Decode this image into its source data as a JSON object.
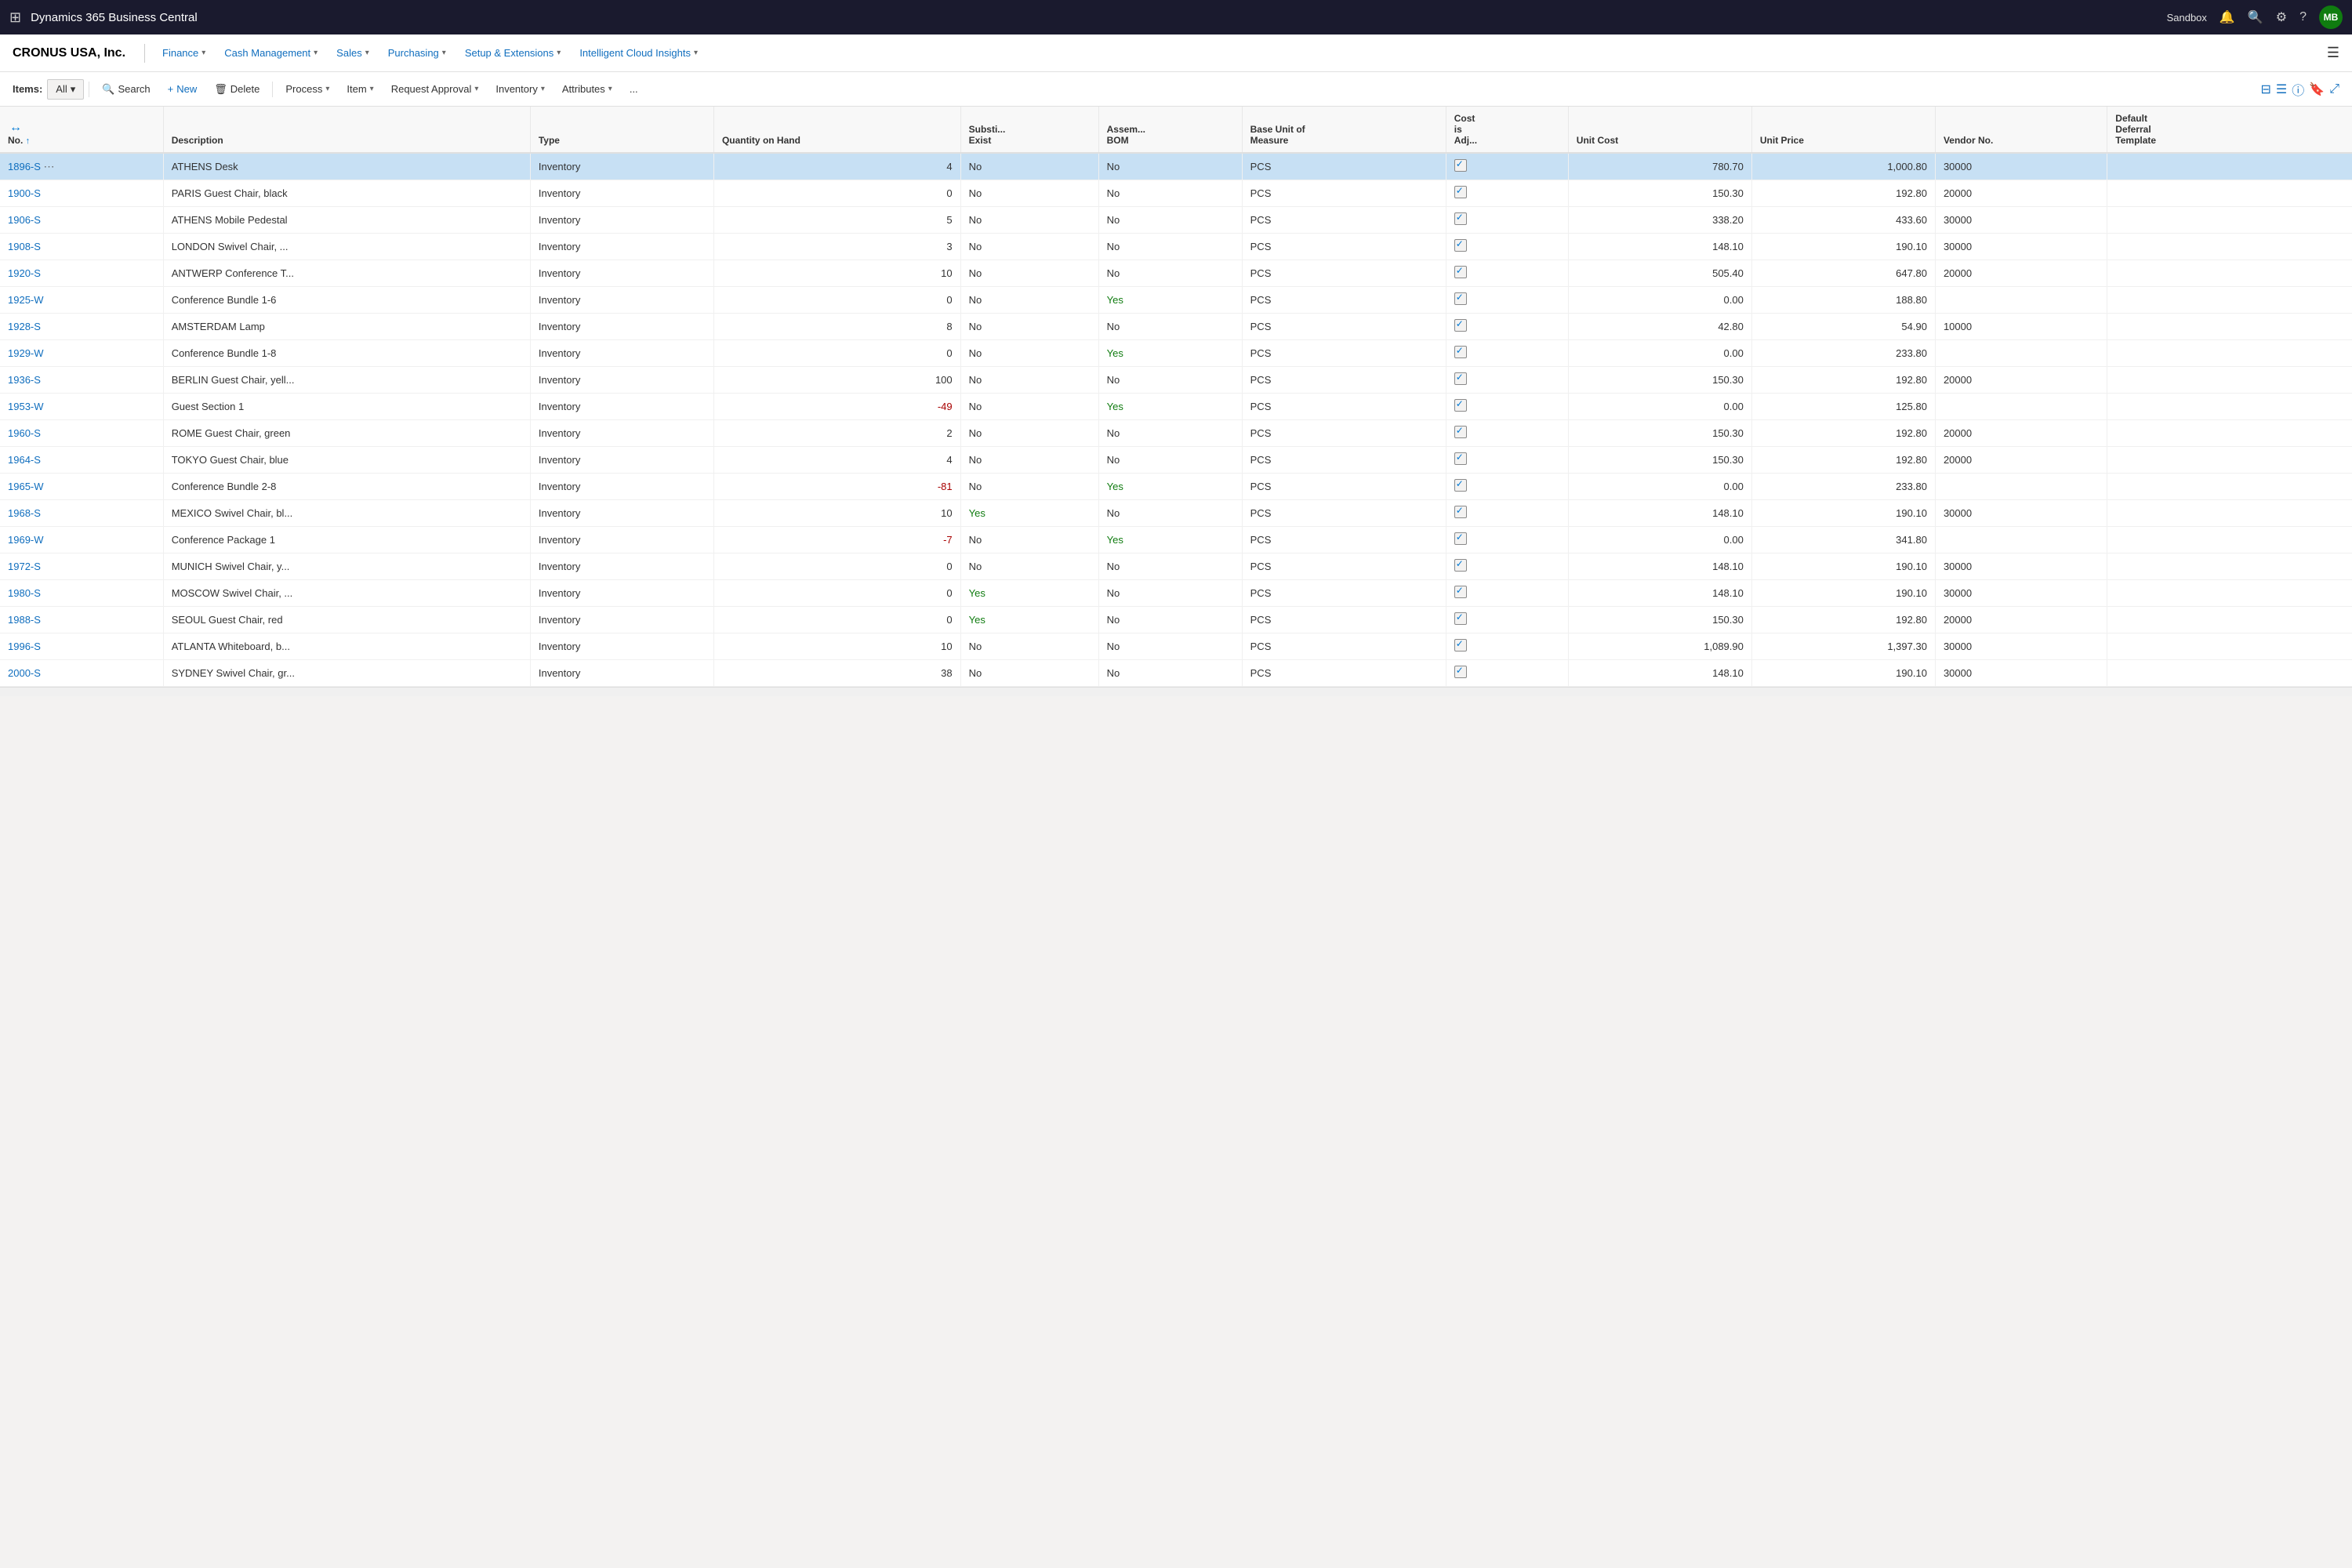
{
  "topNav": {
    "title": "Dynamics 365 Business Central",
    "sandbox": "Sandbox",
    "avatar": "MB"
  },
  "menuBar": {
    "company": "CRONUS USA, Inc.",
    "items": [
      {
        "label": "Finance",
        "hasArrow": true
      },
      {
        "label": "Cash Management",
        "hasArrow": true
      },
      {
        "label": "Sales",
        "hasArrow": true
      },
      {
        "label": "Purchasing",
        "hasArrow": true
      },
      {
        "label": "Setup & Extensions",
        "hasArrow": true
      },
      {
        "label": "Intelligent Cloud Insights",
        "hasArrow": true
      }
    ]
  },
  "toolbar": {
    "itemsLabel": "Items:",
    "filterLabel": "All",
    "buttons": [
      {
        "label": "Search",
        "icon": "🔍",
        "id": "search"
      },
      {
        "label": "New",
        "icon": "+",
        "id": "new"
      },
      {
        "label": "Delete",
        "icon": "🗑",
        "id": "delete"
      },
      {
        "label": "Process",
        "icon": "",
        "id": "process",
        "hasArrow": true
      },
      {
        "label": "Item",
        "icon": "",
        "id": "item",
        "hasArrow": true
      },
      {
        "label": "Request Approval",
        "icon": "",
        "id": "request-approval",
        "hasArrow": true
      },
      {
        "label": "Inventory",
        "icon": "",
        "id": "inventory",
        "hasArrow": true
      },
      {
        "label": "Attributes",
        "icon": "",
        "id": "attributes",
        "hasArrow": true
      },
      {
        "label": "...",
        "icon": "",
        "id": "more"
      }
    ]
  },
  "columns": [
    {
      "id": "no",
      "label": "No. ↑",
      "sortable": true
    },
    {
      "id": "desc",
      "label": "Description"
    },
    {
      "id": "type",
      "label": "Type"
    },
    {
      "id": "qty",
      "label": "Quantity on Hand"
    },
    {
      "id": "subst",
      "label": "Substi... Exist"
    },
    {
      "id": "assem",
      "label": "Assem... BOM"
    },
    {
      "id": "base",
      "label": "Base Unit of Measure"
    },
    {
      "id": "costadj",
      "label": "Cost is Adj..."
    },
    {
      "id": "unitcost",
      "label": "Unit Cost"
    },
    {
      "id": "unitprice",
      "label": "Unit Price"
    },
    {
      "id": "vendor",
      "label": "Vendor No."
    },
    {
      "id": "deferral",
      "label": "Default Deferral Template"
    }
  ],
  "rows": [
    {
      "no": "1896-S",
      "desc": "ATHENS Desk",
      "type": "Inventory",
      "qty": "4",
      "subst": "No",
      "assem": "No",
      "base": "PCS",
      "costadj": true,
      "unitcost": "780.70",
      "unitprice": "1,000.80",
      "vendor": "30000",
      "deferral": "",
      "selected": true
    },
    {
      "no": "1900-S",
      "desc": "PARIS Guest Chair, black",
      "type": "Inventory",
      "qty": "0",
      "subst": "No",
      "assem": "No",
      "base": "PCS",
      "costadj": true,
      "unitcost": "150.30",
      "unitprice": "192.80",
      "vendor": "20000",
      "deferral": "",
      "selected": false
    },
    {
      "no": "1906-S",
      "desc": "ATHENS Mobile Pedestal",
      "type": "Inventory",
      "qty": "5",
      "subst": "No",
      "assem": "No",
      "base": "PCS",
      "costadj": true,
      "unitcost": "338.20",
      "unitprice": "433.60",
      "vendor": "30000",
      "deferral": "",
      "selected": false
    },
    {
      "no": "1908-S",
      "desc": "LONDON Swivel Chair, ...",
      "type": "Inventory",
      "qty": "3",
      "subst": "No",
      "assem": "No",
      "base": "PCS",
      "costadj": true,
      "unitcost": "148.10",
      "unitprice": "190.10",
      "vendor": "30000",
      "deferral": "",
      "selected": false
    },
    {
      "no": "1920-S",
      "desc": "ANTWERP Conference T...",
      "type": "Inventory",
      "qty": "10",
      "subst": "No",
      "assem": "No",
      "base": "PCS",
      "costadj": true,
      "unitcost": "505.40",
      "unitprice": "647.80",
      "vendor": "20000",
      "deferral": "",
      "selected": false
    },
    {
      "no": "1925-W",
      "desc": "Conference Bundle 1-6",
      "type": "Inventory",
      "qty": "0",
      "subst": "No",
      "assem": "Yes",
      "base": "PCS",
      "costadj": true,
      "unitcost": "0.00",
      "unitprice": "188.80",
      "vendor": "",
      "deferral": "",
      "selected": false
    },
    {
      "no": "1928-S",
      "desc": "AMSTERDAM Lamp",
      "type": "Inventory",
      "qty": "8",
      "subst": "No",
      "assem": "No",
      "base": "PCS",
      "costadj": true,
      "unitcost": "42.80",
      "unitprice": "54.90",
      "vendor": "10000",
      "deferral": "",
      "selected": false
    },
    {
      "no": "1929-W",
      "desc": "Conference Bundle 1-8",
      "type": "Inventory",
      "qty": "0",
      "subst": "No",
      "assem": "Yes",
      "base": "PCS",
      "costadj": true,
      "unitcost": "0.00",
      "unitprice": "233.80",
      "vendor": "",
      "deferral": "",
      "selected": false
    },
    {
      "no": "1936-S",
      "desc": "BERLIN Guest Chair, yell...",
      "type": "Inventory",
      "qty": "100",
      "subst": "No",
      "assem": "No",
      "base": "PCS",
      "costadj": true,
      "unitcost": "150.30",
      "unitprice": "192.80",
      "vendor": "20000",
      "deferral": "",
      "selected": false
    },
    {
      "no": "1953-W",
      "desc": "Guest Section 1",
      "type": "Inventory",
      "qty": "-49",
      "subst": "No",
      "assem": "Yes",
      "base": "PCS",
      "costadj": true,
      "unitcost": "0.00",
      "unitprice": "125.80",
      "vendor": "",
      "deferral": "",
      "selected": false
    },
    {
      "no": "1960-S",
      "desc": "ROME Guest Chair, green",
      "type": "Inventory",
      "qty": "2",
      "subst": "No",
      "assem": "No",
      "base": "PCS",
      "costadj": true,
      "unitcost": "150.30",
      "unitprice": "192.80",
      "vendor": "20000",
      "deferral": "",
      "selected": false
    },
    {
      "no": "1964-S",
      "desc": "TOKYO Guest Chair, blue",
      "type": "Inventory",
      "qty": "4",
      "subst": "No",
      "assem": "No",
      "base": "PCS",
      "costadj": true,
      "unitcost": "150.30",
      "unitprice": "192.80",
      "vendor": "20000",
      "deferral": "",
      "selected": false
    },
    {
      "no": "1965-W",
      "desc": "Conference Bundle 2-8",
      "type": "Inventory",
      "qty": "-81",
      "subst": "No",
      "assem": "Yes",
      "base": "PCS",
      "costadj": true,
      "unitcost": "0.00",
      "unitprice": "233.80",
      "vendor": "",
      "deferral": "",
      "selected": false
    },
    {
      "no": "1968-S",
      "desc": "MEXICO Swivel Chair, bl...",
      "type": "Inventory",
      "qty": "10",
      "subst": "Yes",
      "assem": "No",
      "base": "PCS",
      "costadj": true,
      "unitcost": "148.10",
      "unitprice": "190.10",
      "vendor": "30000",
      "deferral": "",
      "selected": false
    },
    {
      "no": "1969-W",
      "desc": "Conference Package 1",
      "type": "Inventory",
      "qty": "-7",
      "subst": "No",
      "assem": "Yes",
      "base": "PCS",
      "costadj": true,
      "unitcost": "0.00",
      "unitprice": "341.80",
      "vendor": "",
      "deferral": "",
      "selected": false
    },
    {
      "no": "1972-S",
      "desc": "MUNICH Swivel Chair, y...",
      "type": "Inventory",
      "qty": "0",
      "subst": "No",
      "assem": "No",
      "base": "PCS",
      "costadj": true,
      "unitcost": "148.10",
      "unitprice": "190.10",
      "vendor": "30000",
      "deferral": "",
      "selected": false
    },
    {
      "no": "1980-S",
      "desc": "MOSCOW Swivel Chair, ...",
      "type": "Inventory",
      "qty": "0",
      "subst": "Yes",
      "assem": "No",
      "base": "PCS",
      "costadj": true,
      "unitcost": "148.10",
      "unitprice": "190.10",
      "vendor": "30000",
      "deferral": "",
      "selected": false
    },
    {
      "no": "1988-S",
      "desc": "SEOUL Guest Chair, red",
      "type": "Inventory",
      "qty": "0",
      "subst": "Yes",
      "assem": "No",
      "base": "PCS",
      "costadj": true,
      "unitcost": "150.30",
      "unitprice": "192.80",
      "vendor": "20000",
      "deferral": "",
      "selected": false
    },
    {
      "no": "1996-S",
      "desc": "ATLANTA Whiteboard, b...",
      "type": "Inventory",
      "qty": "10",
      "subst": "No",
      "assem": "No",
      "base": "PCS",
      "costadj": true,
      "unitcost": "1,089.90",
      "unitprice": "1,397.30",
      "vendor": "30000",
      "deferral": "",
      "selected": false
    },
    {
      "no": "2000-S",
      "desc": "SYDNEY Swivel Chair, gr...",
      "type": "Inventory",
      "qty": "38",
      "subst": "No",
      "assem": "No",
      "base": "PCS",
      "costadj": true,
      "unitcost": "148.10",
      "unitprice": "190.10",
      "vendor": "30000",
      "deferral": "",
      "selected": false
    }
  ],
  "colors": {
    "topNavBg": "#1e1e2e",
    "linkColor": "#106ebe",
    "selectedRowBg": "#c7e0f4",
    "yesColor": "#107c10",
    "negativeColor": "#a80000"
  }
}
